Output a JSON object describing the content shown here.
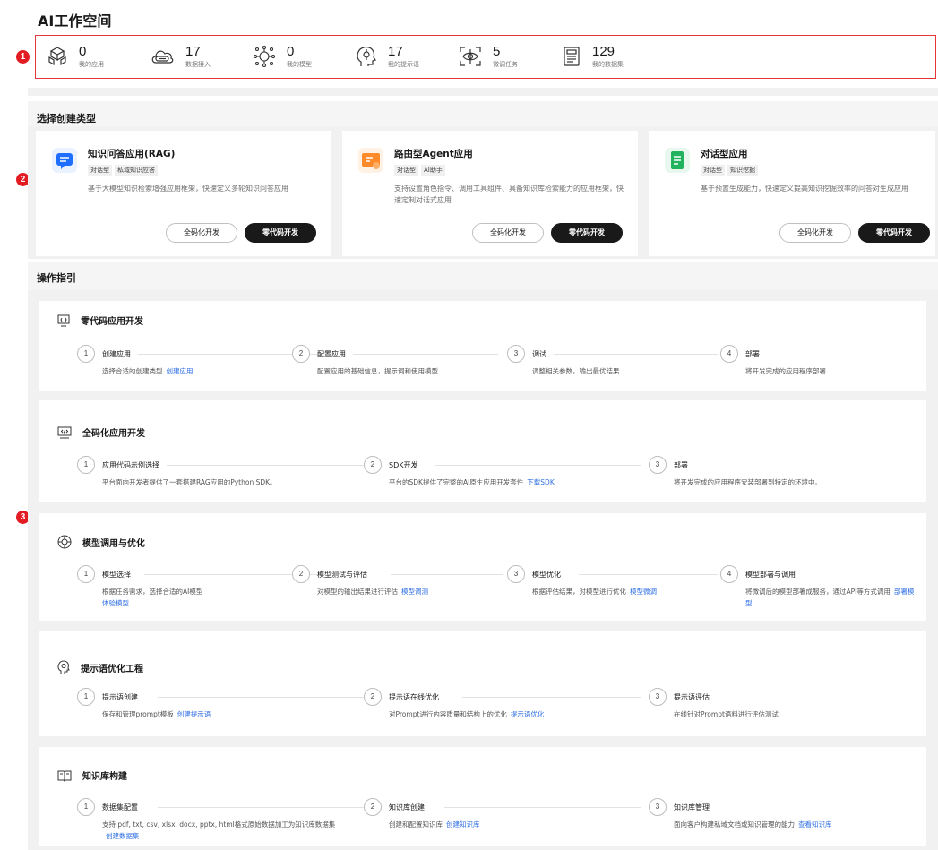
{
  "page": {
    "title": "AI工作空间"
  },
  "callouts": [
    "1",
    "2",
    "3"
  ],
  "stats": [
    {
      "icon": "cubes-icon",
      "value": "0",
      "label": "我的应用"
    },
    {
      "icon": "cloud-drive-icon",
      "value": "17",
      "label": "数据接入"
    },
    {
      "icon": "brain-network-icon",
      "value": "0",
      "label": "我的模型"
    },
    {
      "icon": "head-brain-icon",
      "value": "17",
      "label": "我的提示语"
    },
    {
      "icon": "eye-scan-icon",
      "value": "5",
      "label": "微调任务"
    },
    {
      "icon": "dataset-list-icon",
      "value": "129",
      "label": "我的数据集"
    }
  ],
  "create_section": {
    "title": "选择创建类型",
    "cards": [
      {
        "icon": "chat-bubble-icon",
        "icon_color": "#1e6fff",
        "name": "知识问答应用(RAG)",
        "tags": [
          "对话型",
          "私域知识应答"
        ],
        "desc": "基于大模型知识检索增强应用框架，快速定义多轮知识问答应用",
        "full_code": "全码化开发",
        "zero_code": "零代码开发"
      },
      {
        "icon": "router-icon",
        "icon_color": "#ff8a2a",
        "name": "路由型Agent应用",
        "tags": [
          "对话型",
          "AI助手"
        ],
        "desc": "支持设置角色指令、调用工具组件、具备知识库检索能力的应用框架，快速定制对话式应用",
        "full_code": "全码化开发",
        "zero_code": "零代码开发"
      },
      {
        "icon": "document-icon",
        "icon_color": "#22b35e",
        "name": "对话型应用",
        "tags": [
          "对话型",
          "知识挖掘"
        ],
        "desc": "基于预置生成能力，快速定义提高知识挖掘效率的问答对生成应用",
        "full_code": "全码化开发",
        "zero_code": "零代码开发"
      }
    ]
  },
  "guide_section": {
    "title": "操作指引",
    "guides": [
      {
        "icon": "zero-code-icon",
        "title": "零代码应用开发",
        "steps": [
          {
            "num": "1",
            "title": "创建应用",
            "desc": "选择合适的创建类型",
            "link": "创建应用"
          },
          {
            "num": "2",
            "title": "配置应用",
            "desc": "配置应用的基础信息，提示词和使用模型",
            "link": ""
          },
          {
            "num": "3",
            "title": "调试",
            "desc": "调整相关参数，输出最优结果",
            "link": ""
          },
          {
            "num": "4",
            "title": "部署",
            "desc": "将开发完成的应用程序部署",
            "link": ""
          }
        ]
      },
      {
        "icon": "code-window-icon",
        "title": "全码化应用开发",
        "steps": [
          {
            "num": "1",
            "title": "应用代码示例选择",
            "desc": "平台面向开发者提供了一套搭建RAG应用的Python SDK。",
            "link": ""
          },
          {
            "num": "2",
            "title": "SDK开发",
            "desc": "平台的SDK提供了完整的AI原生应用开发套件",
            "link": "下载SDK"
          },
          {
            "num": "3",
            "title": "部署",
            "desc": "将开发完成的应用程序安装部署到特定的环境中。",
            "link": ""
          }
        ]
      },
      {
        "icon": "model-network-icon",
        "title": "模型调用与优化",
        "steps": [
          {
            "num": "1",
            "title": "模型选择",
            "desc": "根据任务需求，选择合适的AI模型",
            "link": "体验模型"
          },
          {
            "num": "2",
            "title": "模型测试与评估",
            "desc": "对模型的输出结果进行评估",
            "link": "模型调测"
          },
          {
            "num": "3",
            "title": "模型优化",
            "desc": "根据评估结果，对模型进行优化",
            "link": "模型微调"
          },
          {
            "num": "4",
            "title": "模型部署与调用",
            "desc": "将微调后的模型部署成服务，通过API等方式调用",
            "link": "部署模型"
          }
        ]
      },
      {
        "icon": "prompt-head-icon",
        "title": "提示语优化工程",
        "steps": [
          {
            "num": "1",
            "title": "提示语创建",
            "desc": "保存和管理prompt模板",
            "link": "创建提示语"
          },
          {
            "num": "2",
            "title": "提示语在线优化",
            "desc": "对Prompt进行内容质量和结构上的优化",
            "link": "提示语优化"
          },
          {
            "num": "3",
            "title": "提示语评估",
            "desc": "在线针对Prompt语料进行评估测试",
            "link": ""
          }
        ]
      },
      {
        "icon": "knowledge-book-icon",
        "title": "知识库构建",
        "steps": [
          {
            "num": "1",
            "title": "数据集配置",
            "desc": "支持 pdf, txt, csv, xlsx, docx, pptx, html格式原始数据加工为知识库数据集",
            "link": "创建数据集"
          },
          {
            "num": "2",
            "title": "知识库创建",
            "desc": "创建和配置知识库",
            "link": "创建知识库"
          },
          {
            "num": "3",
            "title": "知识库管理",
            "desc": "面向客户构建私域文档或知识管理的能力",
            "link": "查看知识库"
          }
        ]
      }
    ]
  }
}
